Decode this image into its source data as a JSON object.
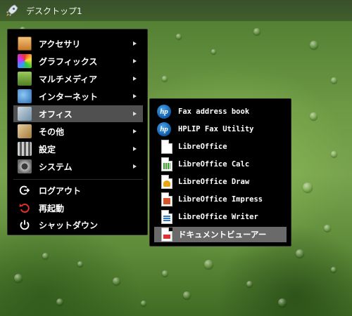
{
  "panel": {
    "title": "デスクトップ1"
  },
  "menu": {
    "items": [
      {
        "label": "アクセサリ",
        "icon": "accessories-icon",
        "color": "#d98b3a"
      },
      {
        "label": "グラフィックス",
        "icon": "graphics-icon",
        "color": "#e04da0"
      },
      {
        "label": "マルチメディア",
        "icon": "multimedia-icon",
        "color": "#7aa83a"
      },
      {
        "label": "インターネット",
        "icon": "internet-icon",
        "color": "#3f8fd6"
      },
      {
        "label": "オフィス",
        "icon": "office-icon",
        "color": "#6f8fa8"
      },
      {
        "label": "その他",
        "icon": "other-icon",
        "color": "#c9a46a"
      },
      {
        "label": "設定",
        "icon": "settings-icon",
        "color": "#9a9a9a"
      },
      {
        "label": "システム",
        "icon": "system-icon",
        "color": "#8a8a8a"
      }
    ],
    "actions": [
      {
        "label": "ログアウト",
        "icon": "logout-icon"
      },
      {
        "label": "再起動",
        "icon": "restart-icon"
      },
      {
        "label": "シャットダウン",
        "icon": "shutdown-icon"
      }
    ]
  },
  "submenu": {
    "items": [
      {
        "label": "Fax address book",
        "icon": "hp-icon"
      },
      {
        "label": "HPLIP Fax Utility",
        "icon": "hp-icon"
      },
      {
        "label": "LibreOffice",
        "icon": "libreoffice-icon",
        "color": "#ffffff"
      },
      {
        "label": "LibreOffice Calc",
        "icon": "libreoffice-calc-icon",
        "color": "#3aa02e"
      },
      {
        "label": "LibreOffice Draw",
        "icon": "libreoffice-draw-icon",
        "color": "#e8a317"
      },
      {
        "label": "LibreOffice Impress",
        "icon": "libreoffice-impress-icon",
        "color": "#d6542a"
      },
      {
        "label": "LibreOffice Writer",
        "icon": "libreoffice-writer-icon",
        "color": "#2f79c4"
      },
      {
        "label": "ドキュメントビューアー",
        "icon": "document-viewer-icon",
        "color": "#d33"
      }
    ],
    "hp_logo": "hp"
  },
  "colors": {
    "menu_bg": "#000000",
    "active_item": "#505050",
    "active_sub": "#6a6a6a"
  }
}
